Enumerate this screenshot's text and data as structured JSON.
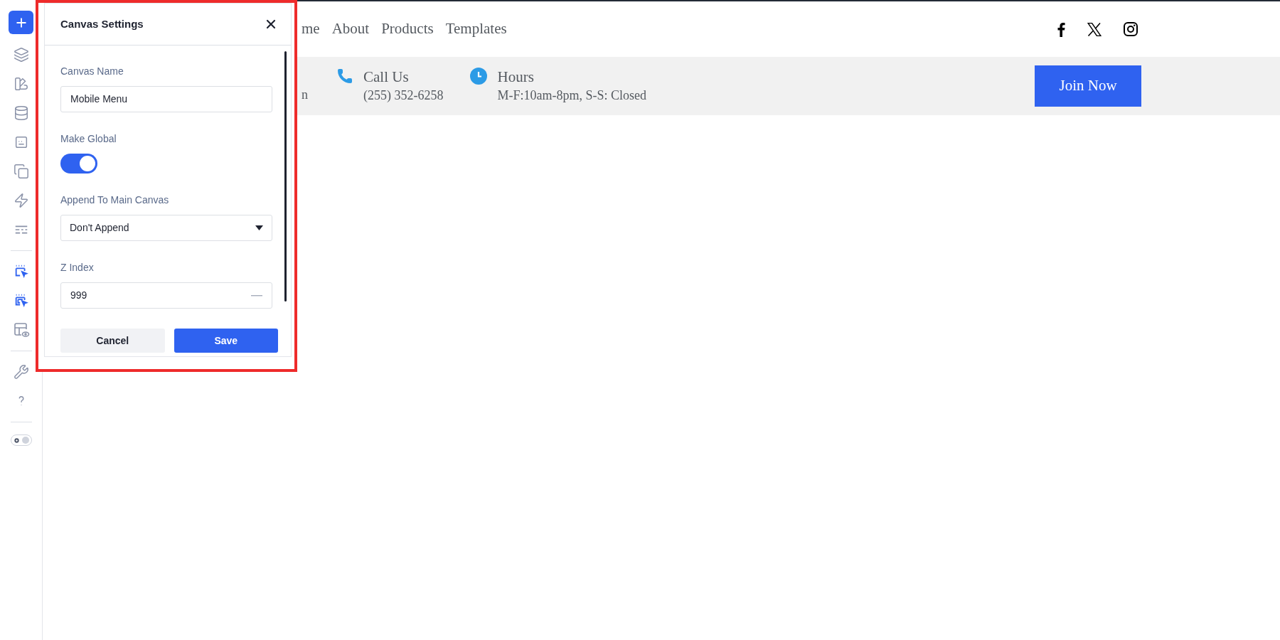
{
  "sidebar": {
    "theme_toggle": {
      "on": true
    }
  },
  "dialog": {
    "title": "Canvas Settings",
    "fields": [
      {
        "kind": "text",
        "label": "Canvas Name",
        "value": "Mobile Menu"
      },
      {
        "kind": "toggle",
        "label": "Make Global",
        "on": true
      },
      {
        "kind": "select",
        "label": "Append To Main Canvas",
        "value": "Don't Append"
      },
      {
        "kind": "number",
        "label": "Z Index",
        "value": "999"
      }
    ],
    "buttons": [
      {
        "kind": "secondary",
        "label": "Cancel"
      },
      {
        "kind": "primary",
        "label": "Save"
      }
    ]
  },
  "site": {
    "nav": [
      "me",
      "About",
      "Products",
      "Templates"
    ],
    "info": [
      {
        "kind": "partial",
        "detail": "n"
      },
      {
        "kind": "phone",
        "title": "Call Us",
        "detail": "(255) 352-6258"
      },
      {
        "kind": "clock",
        "title": "Hours",
        "detail": "M-F:10am-8pm, S-S: Closed"
      }
    ],
    "cta": "Join Now"
  }
}
